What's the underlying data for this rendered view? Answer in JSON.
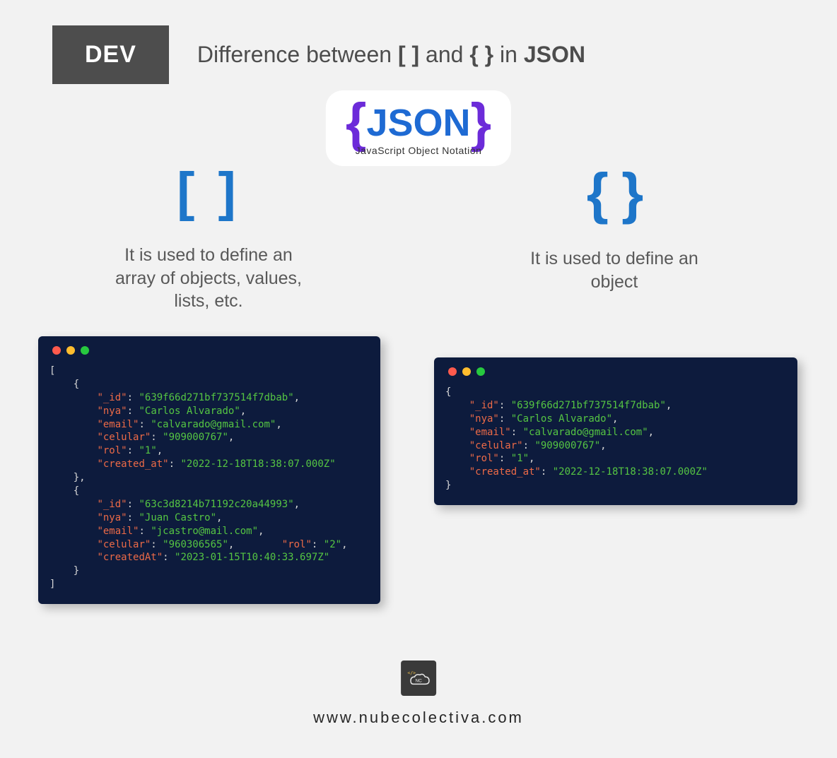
{
  "header": {
    "badge": "DEV",
    "title_pre": "Difference between ",
    "title_brackets": "[ ]",
    "title_mid": " and ",
    "title_braces": "{ }",
    "title_in": " in ",
    "title_json": "JSON"
  },
  "json_logo": {
    "brace_open": "{",
    "text": "JSON",
    "brace_close": "}",
    "subtitle": "JavaScript Object Notation"
  },
  "left": {
    "symbol": "[ ]",
    "desc": "It is used to define an array of objects, values, lists, etc."
  },
  "right": {
    "symbol": "{ }",
    "desc": "It is used to define an object"
  },
  "code_left": {
    "items": [
      {
        "_id": "639f66d271bf737514f7dbab",
        "nya": "Carlos Alvarado",
        "email": "calvarado@gmail.com",
        "celular": "909000767",
        "rol": "1",
        "created_at": "2022-12-18T18:38:07.000Z"
      },
      {
        "_id": "63c3d8214b71192c20a44993",
        "nya": "Juan Castro",
        "email": "jcastro@mail.com",
        "celular": "960306565",
        "rol": "2",
        "createdAt": "2023-01-15T10:40:33.697Z"
      }
    ]
  },
  "code_right": {
    "_id": "639f66d271bf737514f7dbab",
    "nya": "Carlos Alvarado",
    "email": "calvarado@gmail.com",
    "celular": "909000767",
    "rol": "1",
    "created_at": "2022-12-18T18:38:07.000Z"
  },
  "footer": {
    "logo_text": "NC",
    "url": "www.nubecolectiva.com"
  }
}
